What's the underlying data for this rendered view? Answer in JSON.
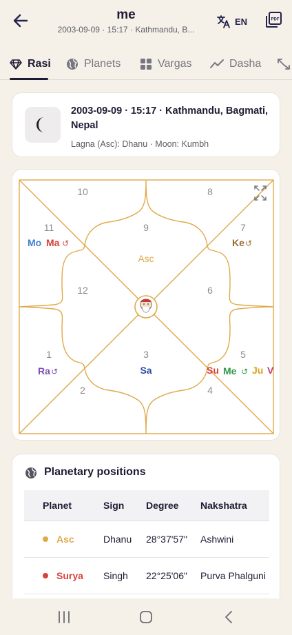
{
  "header": {
    "title": "me",
    "subtitle": "2003-09-09 · 15:17 · Kathmandu, B...",
    "language": "EN"
  },
  "tabs": [
    {
      "label": "Rasi",
      "icon": "diamond-icon",
      "active": true
    },
    {
      "label": "Planets",
      "icon": "globe-icon",
      "active": false
    },
    {
      "label": "Vargas",
      "icon": "grid-icon",
      "active": false
    },
    {
      "label": "Dasha",
      "icon": "trend-icon",
      "active": false
    }
  ],
  "info_card": {
    "title": "2003-09-09 · 15:17 · Kathmandu, Bagmati, Nepal",
    "subtitle": "Lagna (Asc): Dhanu · Moon: Kumbh"
  },
  "chart": {
    "house_numbers": [
      "10",
      "8",
      "11",
      "9",
      "7",
      "12",
      "6",
      "1",
      "3",
      "5",
      "2",
      "4"
    ],
    "asc_label": "Asc",
    "retro_symbol": "↺",
    "planets": {
      "mo": "Mo",
      "ma": "Ma",
      "ke": "Ke",
      "ra": "Ra",
      "sa": "Sa",
      "su": "Su",
      "me": "Me",
      "ju": "Ju",
      "ve": "V"
    },
    "colors": {
      "frame": "#e0a94a",
      "mo": "#3d7fd1",
      "ma": "#d8413a",
      "ke": "#9a6a2a",
      "ra": "#7a4fb3",
      "sa": "#2e4fa8",
      "su": "#d8413a",
      "me": "#2e9a4a",
      "ju": "#d9a21c",
      "ve": "#c23a7a",
      "asc": "#e0a94a"
    }
  },
  "planetary_positions": {
    "title": "Planetary positions",
    "headers": [
      "Planet",
      "Sign",
      "Degree",
      "Nakshatra"
    ],
    "rows": [
      {
        "planet": "Asc",
        "sign": "Dhanu",
        "degree": "28°37'57\"",
        "nakshatra": "Ashwini",
        "color": "#e0a94a"
      },
      {
        "planet": "Surya",
        "sign": "Singh",
        "degree": "22°25'06\"",
        "nakshatra": "Purva Phalguni",
        "color": "#d8413a"
      }
    ]
  }
}
